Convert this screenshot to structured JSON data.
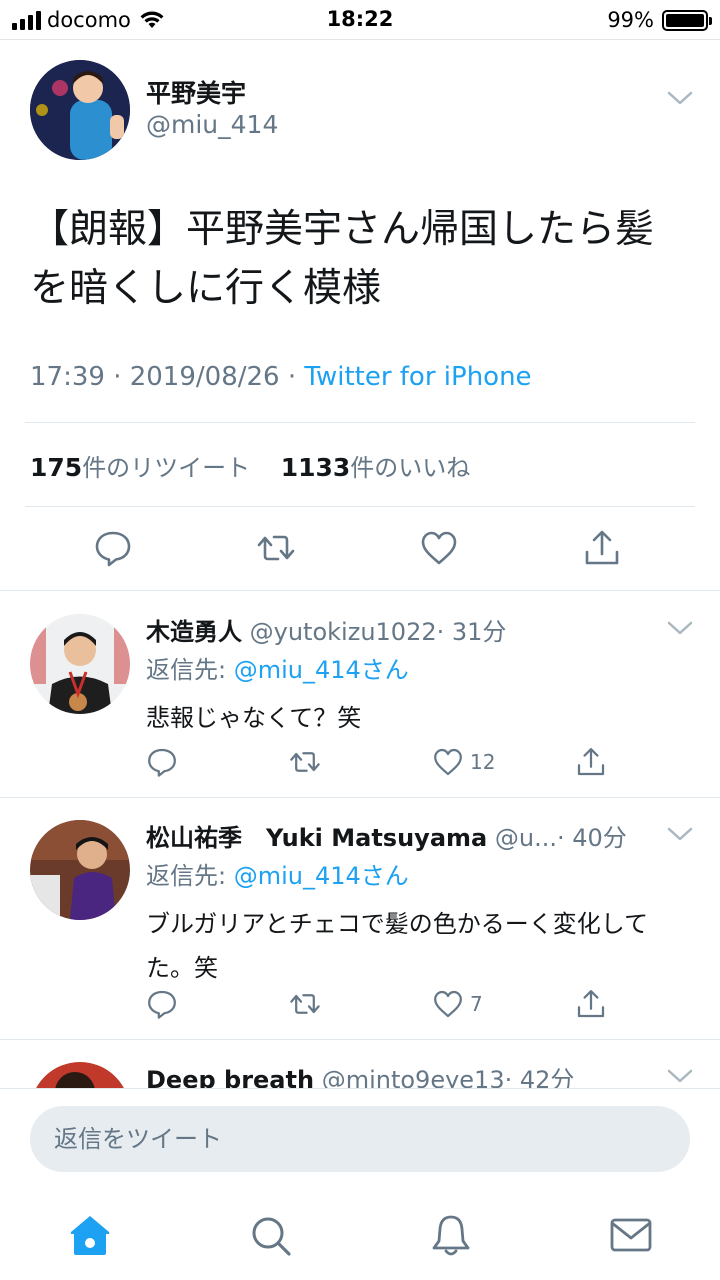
{
  "status_bar": {
    "carrier": "docomo",
    "time": "18:22",
    "battery": "99%",
    "battery_level": 0.99
  },
  "tweet": {
    "author_name": "平野美宇",
    "author_handle": "@miu_414",
    "text": "【朗報】平野美宇さん帰国したら髪を暗くしに行く模様",
    "time": "17:39 · 2019/08/26 · ",
    "via": "Twitter for iPhone",
    "retweet_count": "175",
    "retweet_label": "件のリツイート",
    "like_count": "1133",
    "like_label": "件のいいね",
    "icons": [
      "reply-icon",
      "retweet-icon",
      "like-icon",
      "share-icon"
    ]
  },
  "replies": [
    {
      "name": "木造勇人",
      "handle": "@yutokizu1022",
      "time": "· 31分",
      "reply_to_label": "返信先: ",
      "reply_to": "@miu_414さん",
      "text": "悲報じゃなくて？笑",
      "like_count": "12"
    },
    {
      "name": "松山祐季　Yuki Matsuyama",
      "handle": "@u...",
      "time": "· 40分",
      "reply_to_label": "返信先: ",
      "reply_to": "@miu_414さん",
      "text": "ブルガリアとチェコで髪の色かるーく変化してた。笑",
      "like_count": "7"
    },
    {
      "name": "Deep breath",
      "handle": "@minto9eye13",
      "time": "· 42分"
    }
  ],
  "compose": {
    "placeholder": "返信をツイート"
  },
  "tabbar": {
    "icons": [
      "home-icon",
      "search-icon",
      "notifications-icon",
      "messages-icon"
    ],
    "accent": "#1da1f2"
  }
}
